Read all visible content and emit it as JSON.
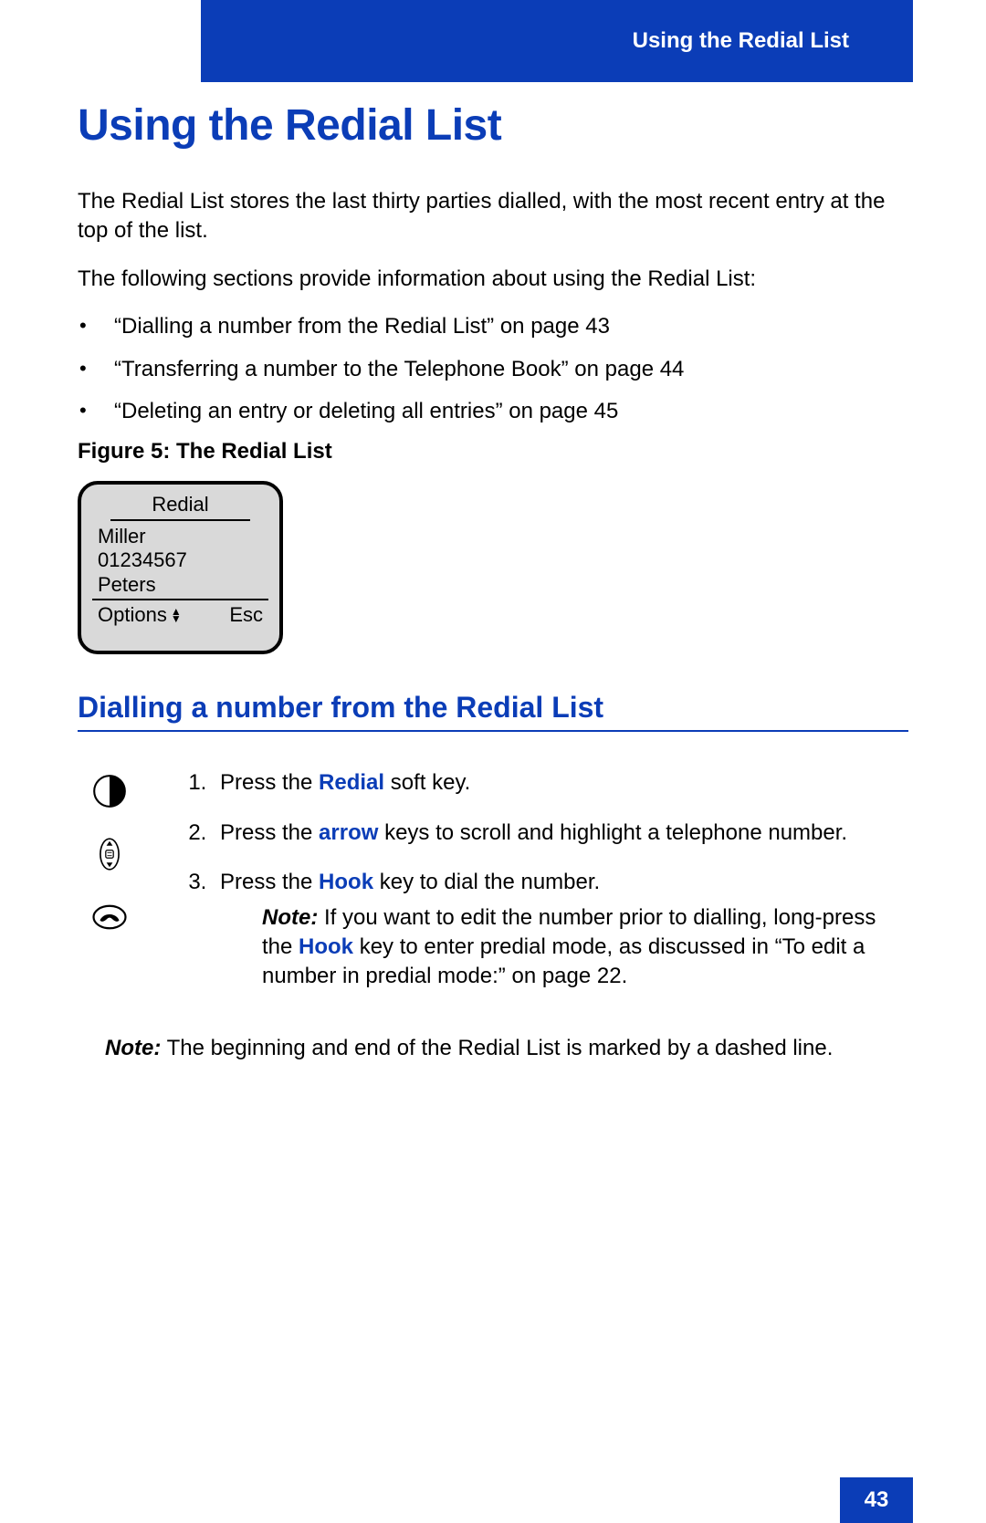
{
  "header": {
    "running_title": "Using the Redial List"
  },
  "headings": {
    "main": "Using the Redial List",
    "figure_caption": "Figure 5: The Redial List",
    "sub": "Dialling a number from the Redial List"
  },
  "intro": {
    "p1": "The Redial List stores the last thirty parties dialled, with the most recent entry at the top of the list.",
    "p2": "The following sections provide information about using the Redial List:"
  },
  "bullets": [
    "“Dialling a number from the Redial List” on page 43",
    "“Transferring a number to the Telephone Book” on page 44",
    "“Deleting an entry or deleting all entries” on page 45"
  ],
  "phone_screen": {
    "title": "Redial",
    "entries": [
      "Miller",
      "01234567",
      "Peters"
    ],
    "footer": {
      "left": "Options",
      "right": "Esc"
    }
  },
  "steps": {
    "s1_a": "Press the ",
    "s1_k": "Redial",
    "s1_b": " soft key.",
    "s2_a": "Press the ",
    "s2_k": "arrow",
    "s2_b": " keys to scroll and highlight a telephone number.",
    "s3_a": "Press the ",
    "s3_k": "Hook",
    "s3_b": " key to dial the number."
  },
  "inline_note": {
    "label": "Note:",
    "a": " If you want to edit the number prior to dialling, long-press the ",
    "k": "Hook",
    "b": " key to enter predial mode, as discussed in “To edit a number in predial mode:” on page 22."
  },
  "final_note": {
    "label": "Note:",
    "text": " The beginning and end of the Redial List is marked by a dashed line."
  },
  "page_number": "43"
}
